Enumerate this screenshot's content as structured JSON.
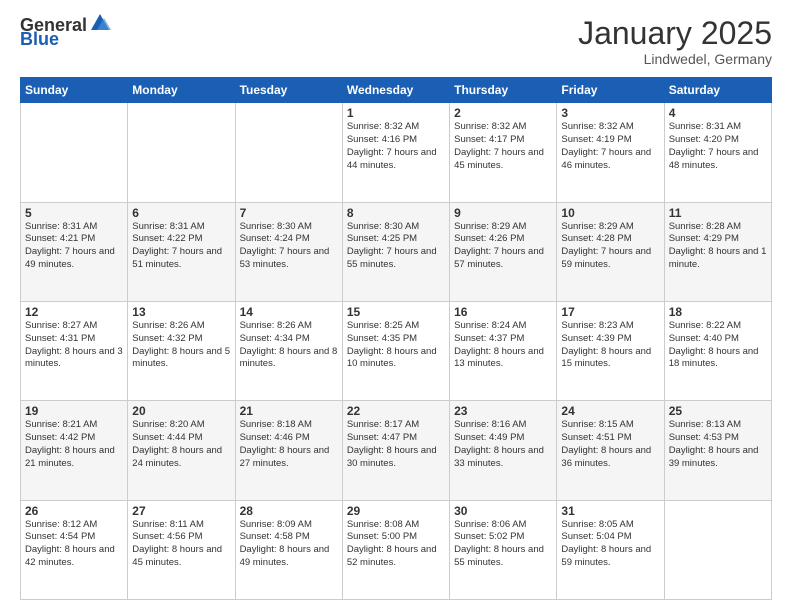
{
  "header": {
    "logo": {
      "general": "General",
      "blue": "Blue"
    },
    "month": "January 2025",
    "location": "Lindwedel, Germany"
  },
  "weekdays": [
    "Sunday",
    "Monday",
    "Tuesday",
    "Wednesday",
    "Thursday",
    "Friday",
    "Saturday"
  ],
  "weeks": [
    [
      {
        "day": "",
        "info": ""
      },
      {
        "day": "",
        "info": ""
      },
      {
        "day": "",
        "info": ""
      },
      {
        "day": "1",
        "info": "Sunrise: 8:32 AM\nSunset: 4:16 PM\nDaylight: 7 hours and 44 minutes."
      },
      {
        "day": "2",
        "info": "Sunrise: 8:32 AM\nSunset: 4:17 PM\nDaylight: 7 hours and 45 minutes."
      },
      {
        "day": "3",
        "info": "Sunrise: 8:32 AM\nSunset: 4:19 PM\nDaylight: 7 hours and 46 minutes."
      },
      {
        "day": "4",
        "info": "Sunrise: 8:31 AM\nSunset: 4:20 PM\nDaylight: 7 hours and 48 minutes."
      }
    ],
    [
      {
        "day": "5",
        "info": "Sunrise: 8:31 AM\nSunset: 4:21 PM\nDaylight: 7 hours and 49 minutes."
      },
      {
        "day": "6",
        "info": "Sunrise: 8:31 AM\nSunset: 4:22 PM\nDaylight: 7 hours and 51 minutes."
      },
      {
        "day": "7",
        "info": "Sunrise: 8:30 AM\nSunset: 4:24 PM\nDaylight: 7 hours and 53 minutes."
      },
      {
        "day": "8",
        "info": "Sunrise: 8:30 AM\nSunset: 4:25 PM\nDaylight: 7 hours and 55 minutes."
      },
      {
        "day": "9",
        "info": "Sunrise: 8:29 AM\nSunset: 4:26 PM\nDaylight: 7 hours and 57 minutes."
      },
      {
        "day": "10",
        "info": "Sunrise: 8:29 AM\nSunset: 4:28 PM\nDaylight: 7 hours and 59 minutes."
      },
      {
        "day": "11",
        "info": "Sunrise: 8:28 AM\nSunset: 4:29 PM\nDaylight: 8 hours and 1 minute."
      }
    ],
    [
      {
        "day": "12",
        "info": "Sunrise: 8:27 AM\nSunset: 4:31 PM\nDaylight: 8 hours and 3 minutes."
      },
      {
        "day": "13",
        "info": "Sunrise: 8:26 AM\nSunset: 4:32 PM\nDaylight: 8 hours and 5 minutes."
      },
      {
        "day": "14",
        "info": "Sunrise: 8:26 AM\nSunset: 4:34 PM\nDaylight: 8 hours and 8 minutes."
      },
      {
        "day": "15",
        "info": "Sunrise: 8:25 AM\nSunset: 4:35 PM\nDaylight: 8 hours and 10 minutes."
      },
      {
        "day": "16",
        "info": "Sunrise: 8:24 AM\nSunset: 4:37 PM\nDaylight: 8 hours and 13 minutes."
      },
      {
        "day": "17",
        "info": "Sunrise: 8:23 AM\nSunset: 4:39 PM\nDaylight: 8 hours and 15 minutes."
      },
      {
        "day": "18",
        "info": "Sunrise: 8:22 AM\nSunset: 4:40 PM\nDaylight: 8 hours and 18 minutes."
      }
    ],
    [
      {
        "day": "19",
        "info": "Sunrise: 8:21 AM\nSunset: 4:42 PM\nDaylight: 8 hours and 21 minutes."
      },
      {
        "day": "20",
        "info": "Sunrise: 8:20 AM\nSunset: 4:44 PM\nDaylight: 8 hours and 24 minutes."
      },
      {
        "day": "21",
        "info": "Sunrise: 8:18 AM\nSunset: 4:46 PM\nDaylight: 8 hours and 27 minutes."
      },
      {
        "day": "22",
        "info": "Sunrise: 8:17 AM\nSunset: 4:47 PM\nDaylight: 8 hours and 30 minutes."
      },
      {
        "day": "23",
        "info": "Sunrise: 8:16 AM\nSunset: 4:49 PM\nDaylight: 8 hours and 33 minutes."
      },
      {
        "day": "24",
        "info": "Sunrise: 8:15 AM\nSunset: 4:51 PM\nDaylight: 8 hours and 36 minutes."
      },
      {
        "day": "25",
        "info": "Sunrise: 8:13 AM\nSunset: 4:53 PM\nDaylight: 8 hours and 39 minutes."
      }
    ],
    [
      {
        "day": "26",
        "info": "Sunrise: 8:12 AM\nSunset: 4:54 PM\nDaylight: 8 hours and 42 minutes."
      },
      {
        "day": "27",
        "info": "Sunrise: 8:11 AM\nSunset: 4:56 PM\nDaylight: 8 hours and 45 minutes."
      },
      {
        "day": "28",
        "info": "Sunrise: 8:09 AM\nSunset: 4:58 PM\nDaylight: 8 hours and 49 minutes."
      },
      {
        "day": "29",
        "info": "Sunrise: 8:08 AM\nSunset: 5:00 PM\nDaylight: 8 hours and 52 minutes."
      },
      {
        "day": "30",
        "info": "Sunrise: 8:06 AM\nSunset: 5:02 PM\nDaylight: 8 hours and 55 minutes."
      },
      {
        "day": "31",
        "info": "Sunrise: 8:05 AM\nSunset: 5:04 PM\nDaylight: 8 hours and 59 minutes."
      },
      {
        "day": "",
        "info": ""
      }
    ]
  ]
}
